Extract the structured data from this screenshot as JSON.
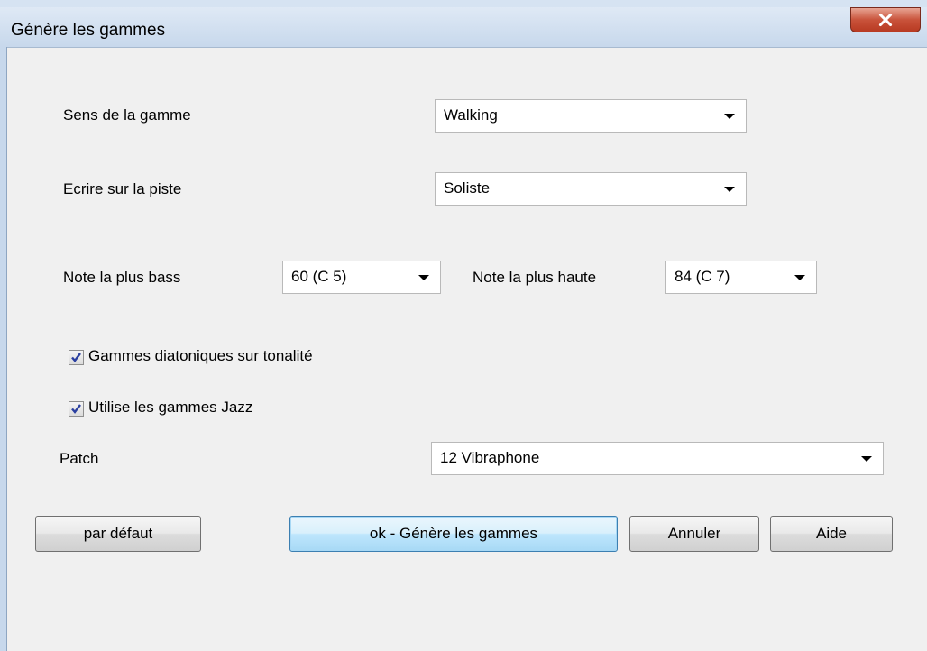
{
  "window": {
    "title": "Génère les gammes"
  },
  "form": {
    "direction": {
      "label": "Sens de la gamme",
      "value": "Walking"
    },
    "track": {
      "label": "Ecrire sur la piste",
      "value": "Soliste"
    },
    "low_note": {
      "label": "Note la plus bass",
      "value": "60  (C 5)"
    },
    "high_note": {
      "label": "Note la plus haute",
      "value": "84  (C 7)"
    },
    "diatonic": {
      "label": "Gammes diatoniques sur tonalité",
      "checked": true
    },
    "jazz": {
      "label": "Utilise les gammes Jazz",
      "checked": true
    },
    "patch": {
      "label": "Patch",
      "value": "12 Vibraphone"
    }
  },
  "buttons": {
    "defaults": "par défaut",
    "ok": "ok - Génère les gammes",
    "cancel": "Annuler",
    "help": "Aide"
  },
  "icons": {
    "close": "close-icon",
    "dropdown": "chevron-down-icon",
    "checkmark": "checkmark-icon"
  }
}
